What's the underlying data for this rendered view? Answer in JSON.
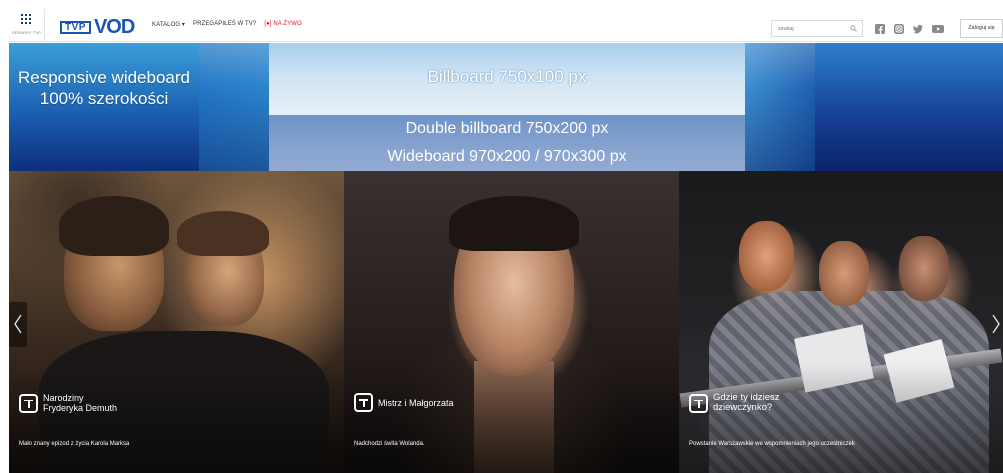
{
  "header": {
    "apps_label": "SERWISY TVP",
    "logo": {
      "tvp": "TVP",
      "vod": "VOD"
    },
    "nav": {
      "katalog": "KATALOG ▾",
      "przegapiles": "PRZEGAPIŁEŚ W TV?",
      "live": "[●] NA ŻYWO"
    },
    "search": {
      "placeholder": "szukaj"
    },
    "socials": [
      "facebook-icon",
      "instagram-icon",
      "twitter-icon",
      "youtube-icon"
    ],
    "login_label": "Zaloguj się"
  },
  "banner": {
    "wideboard_text": "Responsive wideboard 100% szerokości",
    "billboard_text": "Billboard 750x100 px",
    "double_billboard_text": "Double billboard 750x200 px",
    "wideboard_size_text": "Wideboard 970x200 / 970x300 px"
  },
  "slides": [
    {
      "title_line1": "Narodziny",
      "title_line2": "Fryderyka Demuth",
      "description": "Mało znany epizod z życia Karola Marksa"
    },
    {
      "title_line1": "Mistrz i Małgorzata",
      "title_line2": "",
      "description": "Nadchodzi świta Wolanda."
    },
    {
      "title_line1": "Gdzie ty idziesz",
      "title_line2": "dziewczynko?",
      "description": "Powstanie Warszawskie we wspomnieniach jego uczestniczek"
    }
  ],
  "colors": {
    "brand_blue": "#1b56b5",
    "live_red": "#e0142f"
  }
}
